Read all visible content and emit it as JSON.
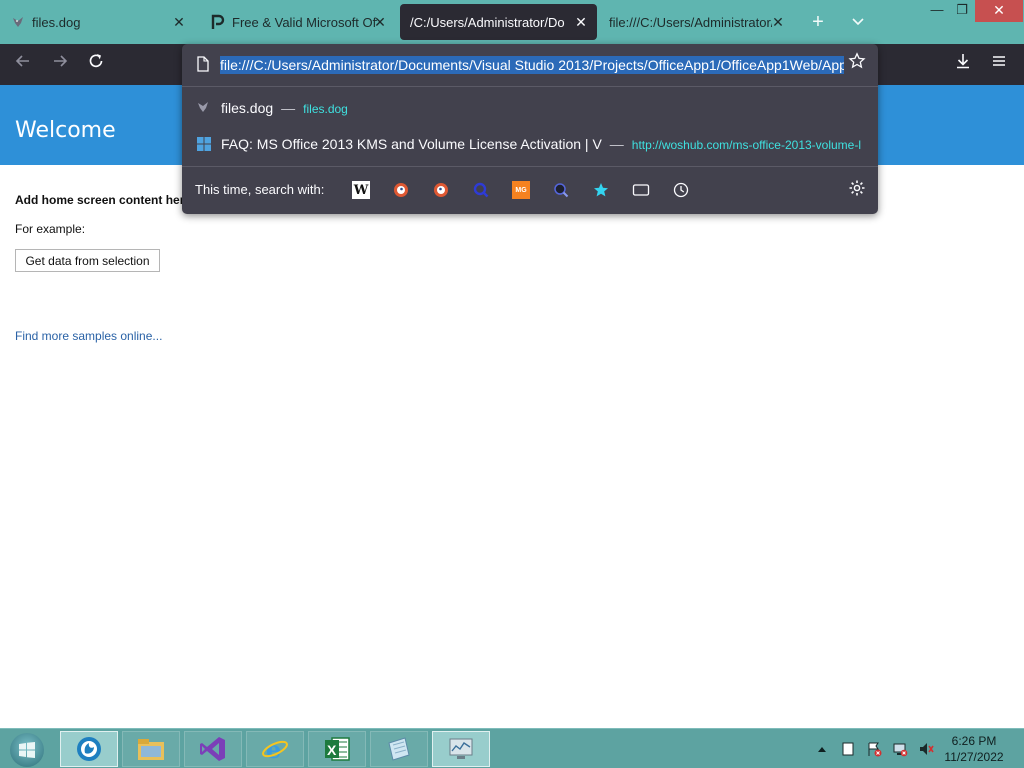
{
  "browser": {
    "tabs": [
      {
        "title": "files.dog",
        "icon": "bird-favicon",
        "active": false
      },
      {
        "title": "Free & Valid Microsoft Offi",
        "icon": "p-logo-favicon",
        "active": false
      },
      {
        "title": "/C:/Users/Administrator/Docu",
        "icon": "",
        "active": true
      },
      {
        "title": "file:///C:/Users/Administrator/",
        "icon": "",
        "active": false
      }
    ],
    "new_tab_icon": "plus-icon",
    "tab_list_icon": "chevron-down-icon",
    "window_controls": {
      "minimize": "—",
      "restore": "❐",
      "close": "✕"
    }
  },
  "toolbar": {
    "back_icon": "arrow-left-icon",
    "forward_icon": "arrow-right-icon",
    "reload_icon": "reload-icon",
    "download_icon": "download-icon",
    "menu_icon": "hamburger-icon"
  },
  "urlbar": {
    "value": "file:///C:/Users/Administrator/Documents/Visual Studio 2013/Projects/OfficeApp1/OfficeApp1Web/App",
    "results": [
      {
        "title": "files.dog",
        "separator": "—",
        "url": "files.dog"
      },
      {
        "title": "FAQ: MS Office 2013 KMS and Volume License Activation | V",
        "separator": "—",
        "url": "http://woshub.com/ms-office-2013-volume-l"
      }
    ],
    "search_with_label": "This time, search with:",
    "engines": [
      "wikipedia",
      "duckduckgo",
      "duckduckgo-alt",
      "search-magnifier",
      "mg",
      "dark-search",
      "bookmarks",
      "tabs",
      "history"
    ]
  },
  "page": {
    "title": "Welcome",
    "heading": "Add home screen content her",
    "example": "For example:",
    "button": "Get data from selection",
    "link": "Find more samples online..."
  },
  "taskbar": {
    "apps": [
      "firefox",
      "file-explorer",
      "visual-studio",
      "internet-explorer",
      "excel",
      "notepad",
      "resource-monitor"
    ],
    "clock_time": "6:26 PM",
    "clock_date": "11/27/2022"
  },
  "colors": {
    "tabstrip": "#5fb5b0",
    "toolbar": "#2b2a33",
    "urlbar_panel": "#42414d",
    "page_header": "#2e90d8",
    "link": "#2a62a6",
    "result_url": "#3fe1e0",
    "taskbar": "#5da3a1"
  }
}
